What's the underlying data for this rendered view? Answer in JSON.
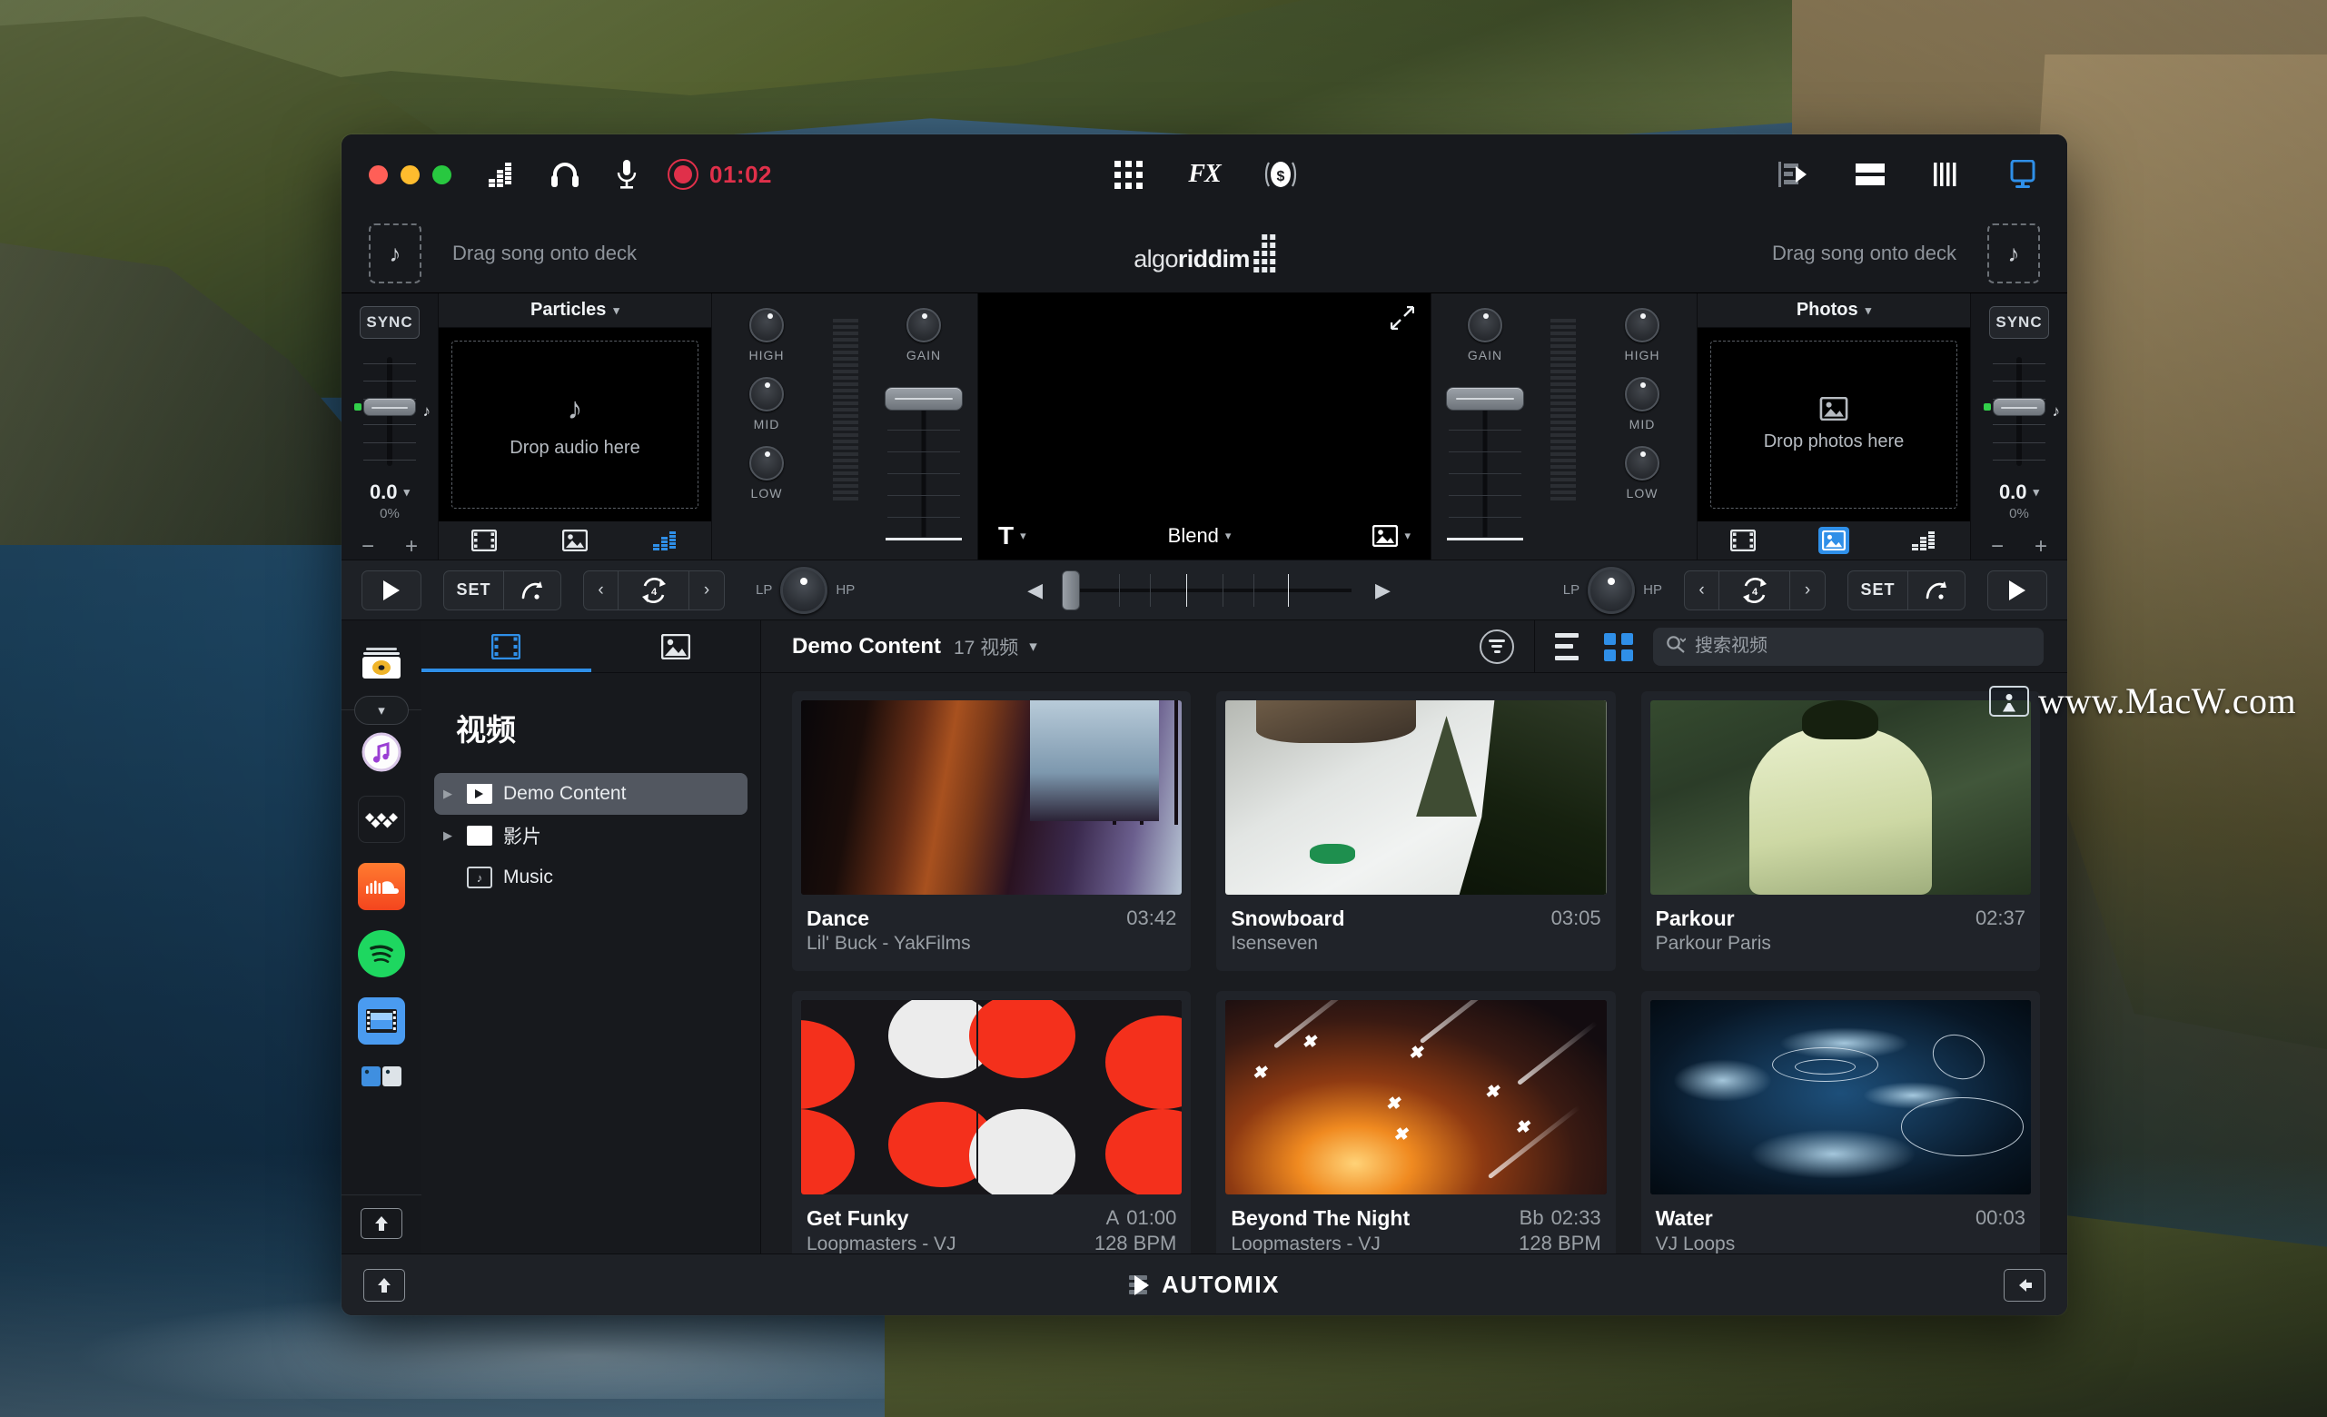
{
  "titlebar": {
    "record_time": "01:02",
    "icons": [
      "equalizer-icon",
      "headphones-icon",
      "microphone-icon",
      "record-icon"
    ],
    "center_icons": [
      "grid-pads-icon",
      "fx-icon",
      "effects-circle-icon"
    ],
    "fx_label": "FX",
    "right_icons": [
      "automix-view-icon",
      "split-view-icon",
      "columns-view-icon",
      "display-output-icon"
    ]
  },
  "deck_row": {
    "left_drop": "Drag song onto deck",
    "right_drop": "Drag song onto deck",
    "logo_prefix": "algo",
    "logo_suffix": "riddim"
  },
  "mixer": {
    "left_deck": {
      "sync": "SYNC",
      "gain_value": "0.0",
      "gain_percent": "0%",
      "title": "Particles",
      "drop_text": "Drop audio here",
      "tabs": [
        "video-tab",
        "photo-tab",
        "audio-tab"
      ],
      "active_tab": "audio-tab"
    },
    "right_deck": {
      "sync": "SYNC",
      "gain_value": "0.0",
      "gain_percent": "0%",
      "title": "Photos",
      "drop_text": "Drop photos here",
      "tabs": [
        "video-tab",
        "photo-tab",
        "audio-tab"
      ],
      "active_tab": "photo-tab"
    },
    "eq_labels": [
      "HIGH",
      "MID",
      "LOW"
    ],
    "gain_label": "GAIN",
    "preview": {
      "text_mode": "T",
      "blend_mode": "Blend",
      "image_mode": "image-icon"
    }
  },
  "transport": {
    "set_label": "SET",
    "loop_beats": "4",
    "filter_low": "LP",
    "filter_high": "HP",
    "play_icon": "play-icon"
  },
  "browser": {
    "rail_items": [
      "collection-icon",
      "collapse-chevron-icon",
      "itunes-icon",
      "tidal-icon",
      "soundcloud-icon",
      "spotify-icon",
      "video-library-icon",
      "photo-library-icon"
    ],
    "rail_bottom": "eject-icon",
    "tree_tabs": [
      "video-tab",
      "photo-tab"
    ],
    "tree_active_tab": "video-tab",
    "tree_title": "视频",
    "tree_items": [
      {
        "label": "Demo Content",
        "icon": "play-folder-icon",
        "selected": true,
        "expandable": true
      },
      {
        "label": "影片",
        "icon": "folder-icon",
        "selected": false,
        "expandable": true
      },
      {
        "label": "Music",
        "icon": "music-folder-icon",
        "selected": false,
        "expandable": false
      }
    ],
    "header": {
      "title": "Demo Content",
      "count": "17 视频",
      "filter_icon": "filter-icon",
      "list_view_icon": "list-view-icon",
      "grid_view_icon": "grid-view-icon",
      "active_view": "grid-view-icon"
    },
    "search": {
      "placeholder": "搜索视频",
      "value": ""
    },
    "cards": [
      {
        "title": "Dance",
        "subtitle": "Lil' Buck - YakFilms",
        "key": "",
        "duration": "03:42",
        "bpm": "",
        "art": "dance"
      },
      {
        "title": "Snowboard",
        "subtitle": "Isenseven",
        "key": "",
        "duration": "03:05",
        "bpm": "",
        "art": "snow"
      },
      {
        "title": "Parkour",
        "subtitle": "Parkour Paris",
        "key": "",
        "duration": "02:37",
        "bpm": "",
        "art": "parkour"
      },
      {
        "title": "Get Funky",
        "subtitle": "Loopmasters - VJ",
        "key": "A",
        "duration": "01:00",
        "bpm": "128 BPM",
        "art": "funky"
      },
      {
        "title": "Beyond The Night",
        "subtitle": "Loopmasters - VJ",
        "key": "Bb",
        "duration": "02:33",
        "bpm": "128 BPM",
        "art": "night"
      },
      {
        "title": "Water",
        "subtitle": "VJ Loops",
        "key": "",
        "duration": "00:03",
        "bpm": "",
        "art": "water"
      }
    ]
  },
  "automix": {
    "label": "AUTOMIX",
    "left_icon": "load-up-icon",
    "right_icon": "load-left-icon"
  },
  "watermark": {
    "text": "www.MacW.com"
  },
  "colors": {
    "accent_blue": "#2f8fe8",
    "record_red": "#e0304a",
    "window_bg": "#16181c",
    "panel_bg": "#1a1c20",
    "selected_row": "#525760"
  }
}
